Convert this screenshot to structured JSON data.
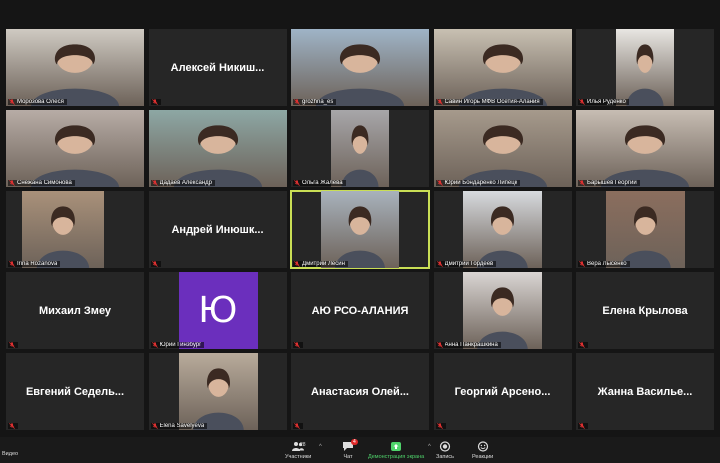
{
  "participants": [
    {
      "name": "Морозова Олеся",
      "video": true,
      "bg": "#cfcac2",
      "vx": 0,
      "vw": 138
    },
    {
      "name": "Алексей Никиш...",
      "video": false
    },
    {
      "name": "grozhna_es",
      "video": true,
      "bg": "#9fb4c7",
      "vx": 0,
      "vw": 138
    },
    {
      "name": "Савин Игорь МФВ Осетия-Алания",
      "video": true,
      "bg": "#c8c0b2",
      "vx": 0,
      "vw": 138
    },
    {
      "name": "Илья Руденко",
      "video": true,
      "bg": "#e8e6e2",
      "vx": 40,
      "vw": 58
    },
    {
      "name": "Снежана Симонова",
      "video": true,
      "bg": "#b7aca6",
      "vx": 0,
      "vw": 138
    },
    {
      "name": "Дадаев Александр",
      "video": true,
      "bg": "#8da7a4",
      "vx": 0,
      "vw": 138
    },
    {
      "name": "Ольга Жалева",
      "video": true,
      "bg": "#a7a6a9",
      "vx": 40,
      "vw": 58
    },
    {
      "name": "Юрий Бондаренко Липецк",
      "video": true,
      "bg": "#a69a8c",
      "vx": 0,
      "vw": 138
    },
    {
      "name": "Барышев Георгий",
      "video": true,
      "bg": "#c7bdb3",
      "vx": 0,
      "vw": 138
    },
    {
      "name": "Irina Rozanova",
      "video": true,
      "bg": "#a9917a",
      "vx": 16,
      "vw": 82
    },
    {
      "name": "Андрей Инюшк...",
      "video": false
    },
    {
      "name": "Дмитрий Лесин",
      "video": true,
      "bg": "#a8b2bc",
      "vx": 30,
      "vw": 78,
      "active": true
    },
    {
      "name": "Дмитрий Гордеев",
      "video": true,
      "bg": "#d7dade",
      "vx": 29,
      "vw": 79
    },
    {
      "name": "Вера Лысенко",
      "video": true,
      "bg": "#8b6e5e",
      "vx": 30,
      "vw": 79
    },
    {
      "name": "Михаил Змеу",
      "video": false
    },
    {
      "name": "Юрий Гинзбург",
      "video": false,
      "avatar": "Ю"
    },
    {
      "name": "АЮ РСО-АЛАНИЯ",
      "video": false
    },
    {
      "name": "Анна Панкрашкина",
      "video": true,
      "bg": "#d9d5d3",
      "vx": 29,
      "vw": 79
    },
    {
      "name": "Елена Крылова",
      "video": false
    },
    {
      "name": "Евгений Седель...",
      "video": false
    },
    {
      "name": "Elena Savelyeva",
      "video": true,
      "bg": "#b8ab9b",
      "vx": 30,
      "vw": 79
    },
    {
      "name": "Анастасия Олей...",
      "video": false
    },
    {
      "name": "Георгий Арсено...",
      "video": false
    },
    {
      "name": "Жанна Василье...",
      "video": false
    }
  ],
  "toolbar": {
    "left_label": "Видео",
    "participants_label": "Участники",
    "participants_count": "28",
    "chat_label": "Чат",
    "chat_badge": "4",
    "share_label": "Демонстрация экрана",
    "record_label": "Запись",
    "reactions_label": "Реакции"
  },
  "colors": {
    "active_border": "#c9de55",
    "mute_icon": "#e03131",
    "share_green": "#4fd36b",
    "avatar_purple": "#6b2fbd"
  }
}
